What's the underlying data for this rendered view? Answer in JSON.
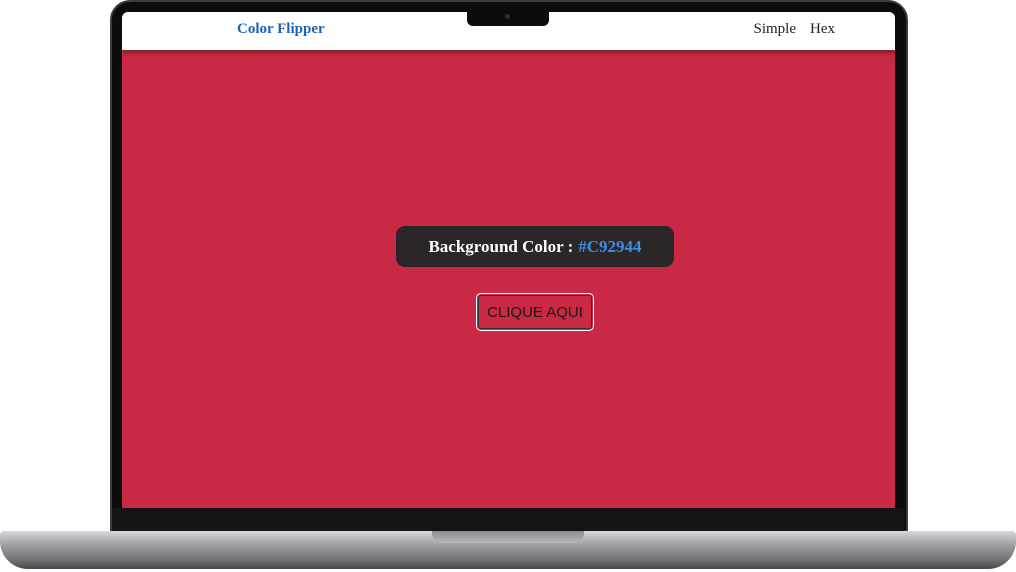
{
  "navbar": {
    "brand": "Color Flipper",
    "links": [
      "Simple",
      "Hex"
    ]
  },
  "main": {
    "label": "Background Color :",
    "hex_value": "#C92944",
    "button_label": "CLIQUE AQUI"
  },
  "colors": {
    "background": "#c92944",
    "brand": "#1f63b8",
    "hex_text": "#3a8ee6",
    "panel": "#2b2628"
  }
}
